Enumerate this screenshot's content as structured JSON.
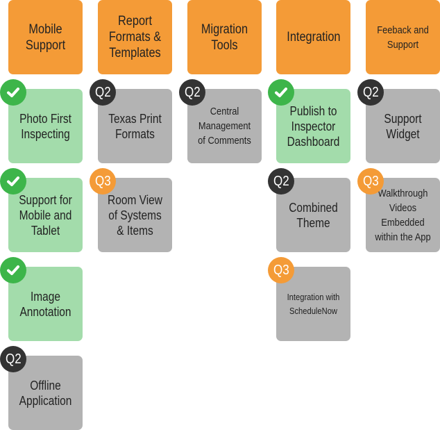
{
  "colors": {
    "header": "#f49b37",
    "done_card": "#a3dcab",
    "pending_card": "#b3b3b3",
    "done_badge": "#3db54a",
    "q2_badge": "#333333",
    "q3_badge": "#f49b37"
  },
  "columns": [
    {
      "title": "Mobile Support",
      "items": [
        {
          "label": "Photo First Inspecting",
          "status": "done",
          "badge": "check-icon"
        },
        {
          "label": "Support for Mobile and Tablet",
          "status": "done",
          "badge": "check-icon"
        },
        {
          "label": "Image Annotation",
          "status": "done",
          "badge": "check-icon"
        },
        {
          "label": "Offline Application",
          "status": "Q2",
          "badge": "Q2"
        }
      ]
    },
    {
      "title": "Report Formats & Templates",
      "items": [
        {
          "label": "Texas Print Formats",
          "status": "Q2",
          "badge": "Q2"
        },
        {
          "label": "Room View of Systems & Items",
          "status": "Q3",
          "badge": "Q3"
        }
      ]
    },
    {
      "title": "Migration Tools",
      "items": [
        {
          "label": "Central Management of Comments",
          "status": "Q2",
          "badge": "Q2"
        }
      ]
    },
    {
      "title": "Integration",
      "items": [
        {
          "label": "Publish to Inspector Dashboard",
          "status": "done",
          "badge": "check-icon"
        },
        {
          "label": "Combined Theme",
          "status": "Q2",
          "badge": "Q2"
        },
        {
          "label": "Integration with ScheduleNow",
          "status": "Q3",
          "badge": "Q3"
        }
      ]
    },
    {
      "title": "Feeback and Support",
      "items": [
        {
          "label": "Support Widget",
          "status": "Q2",
          "badge": "Q2"
        },
        {
          "label": "Walkthrough Videos Embedded within the App",
          "status": "Q3",
          "badge": "Q3"
        }
      ]
    }
  ]
}
